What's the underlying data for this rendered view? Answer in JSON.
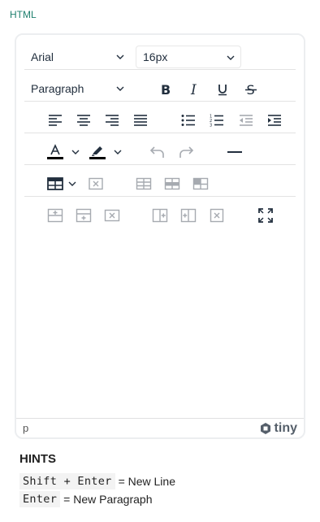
{
  "tab_label": "HTML",
  "toolbar": {
    "font_family": "Arial",
    "font_size": "16px",
    "block_format": "Paragraph"
  },
  "statusbar": {
    "path": "p",
    "brand": "tiny"
  },
  "hints": {
    "title": "HINTS",
    "items": [
      {
        "key": "Shift + Enter",
        "desc": "= New Line"
      },
      {
        "key": "Enter",
        "desc": "= New Paragraph"
      }
    ]
  },
  "colors": {
    "tab_label": "#1e7f6e",
    "icon": "#222f3e",
    "icon_disabled": "#a6aab0",
    "text_color_swatch": "#000000",
    "highlight_swatch": "#000000"
  },
  "icons": {
    "row2": [
      "bold-icon",
      "italic-icon",
      "underline-icon",
      "strikethrough-icon"
    ],
    "row3": [
      "align-left-icon",
      "align-center-icon",
      "align-right-icon",
      "align-justify-icon",
      "bullet-list-icon",
      "numbered-list-icon",
      "outdent-icon",
      "indent-icon"
    ],
    "row4": [
      "text-color-icon",
      "highlight-color-icon",
      "undo-icon",
      "redo-icon",
      "horizontal-line-icon"
    ],
    "row5": [
      "table-icon",
      "delete-table-icon",
      "table-properties-icon",
      "table-row-properties-icon",
      "table-cell-properties-icon"
    ],
    "row6": [
      "insert-row-before-icon",
      "insert-row-after-icon",
      "delete-row-icon",
      "insert-column-before-icon",
      "insert-column-after-icon",
      "delete-column-icon",
      "fullscreen-icon"
    ]
  }
}
